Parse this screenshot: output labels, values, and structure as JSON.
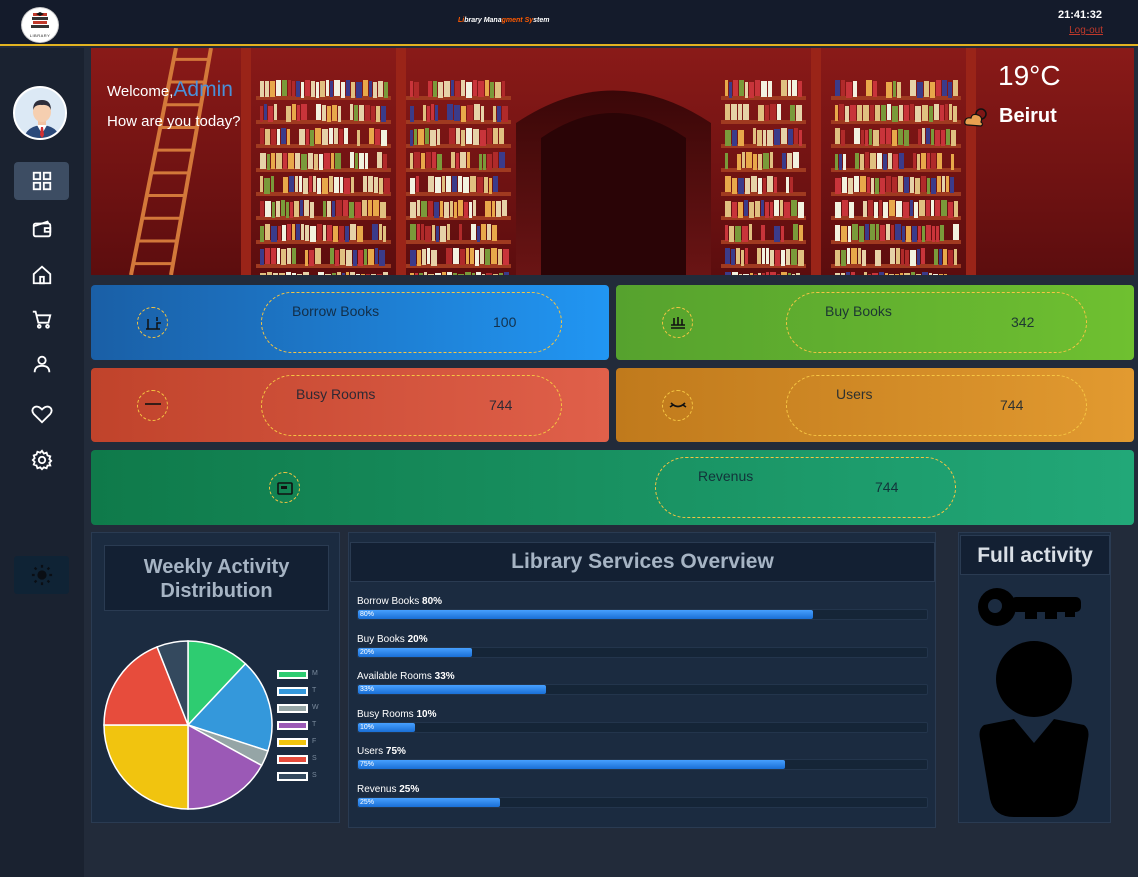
{
  "topbar": {
    "logo_text": "LIBRARY",
    "title_parts": [
      {
        "text": "Li",
        "color": "#ff5a00"
      },
      {
        "text": "brary ",
        "color": "#ffffff"
      },
      {
        "text": "Mana",
        "color": "#ffffff"
      },
      {
        "text": "gment ",
        "color": "#ff5a00"
      },
      {
        "text": "Sy",
        "color": "#ff5a00"
      },
      {
        "text": "stem",
        "color": "#ffffff"
      }
    ],
    "time": "21:41:32",
    "logout": "Log-out"
  },
  "sidebar": {
    "items": [
      {
        "name": "dashboard-icon",
        "active": true
      },
      {
        "name": "wallet-icon",
        "active": false
      },
      {
        "name": "home-icon",
        "active": false
      },
      {
        "name": "cart-icon",
        "active": false
      },
      {
        "name": "user-icon",
        "active": false
      },
      {
        "name": "heart-icon",
        "active": false
      },
      {
        "name": "gear-icon",
        "active": false
      }
    ],
    "theme_icon": "sun-icon"
  },
  "hero": {
    "welcome": "Welcome,",
    "user": "Admin",
    "greeting": "How are you today?",
    "temperature": "19°C",
    "city": "Beirut",
    "weather_icon": "partly-cloudy-icon"
  },
  "stats": [
    {
      "key": "borrow",
      "label": "Borrow Books",
      "value": "100",
      "icon": "desk-icon",
      "color_start": "#1a5fa6",
      "color_end": "#2196f3"
    },
    {
      "key": "buy",
      "label": "Buy Books",
      "value": "342",
      "icon": "bookshelf-icon",
      "color_start": "#56a22e",
      "color_end": "#6fc030"
    },
    {
      "key": "rooms",
      "label": "Busy Rooms",
      "value": "744",
      "icon": "room-icon",
      "color_start": "#c0432b",
      "color_end": "#e0604a"
    },
    {
      "key": "users",
      "label": "Users",
      "value": "744",
      "icon": "users-icon",
      "color_start": "#c07a1c",
      "color_end": "#e29a30"
    },
    {
      "key": "revenue",
      "label": "Revenus",
      "value": "744",
      "icon": "cash-register-icon",
      "color_start": "#0f7a4a",
      "color_end": "#22a878"
    }
  ],
  "weekly": {
    "title": "Weekly Activity Distribution",
    "legend": [
      "M",
      "T",
      "W",
      "T",
      "F",
      "S",
      "S"
    ]
  },
  "services": {
    "title": "Library Services Overview",
    "items": [
      {
        "name": "Borrow Books",
        "percent": "80%",
        "value": 80
      },
      {
        "name": "Buy Books",
        "percent": "20%",
        "value": 20
      },
      {
        "name": "Available Rooms",
        "percent": "33%",
        "value": 33
      },
      {
        "name": "Busy Rooms",
        "percent": "10%",
        "value": 10
      },
      {
        "name": "Users",
        "percent": "75%",
        "value": 75
      },
      {
        "name": "Revenus",
        "percent": "25%",
        "value": 25
      }
    ]
  },
  "full_activity": {
    "title": "Full activity",
    "icons": [
      "key-icon",
      "user-silhouette-icon"
    ]
  },
  "chart_data": {
    "type": "pie",
    "categories": [
      "M",
      "T",
      "W",
      "T",
      "F",
      "S",
      "S"
    ],
    "values": [
      12,
      18,
      3,
      17,
      25,
      19,
      6
    ],
    "colors": [
      "#2ecc71",
      "#3498db",
      "#95a5a6",
      "#9b59b6",
      "#f1c40f",
      "#e74c3c",
      "#34495e"
    ],
    "title": "Weekly Activity Distribution"
  }
}
